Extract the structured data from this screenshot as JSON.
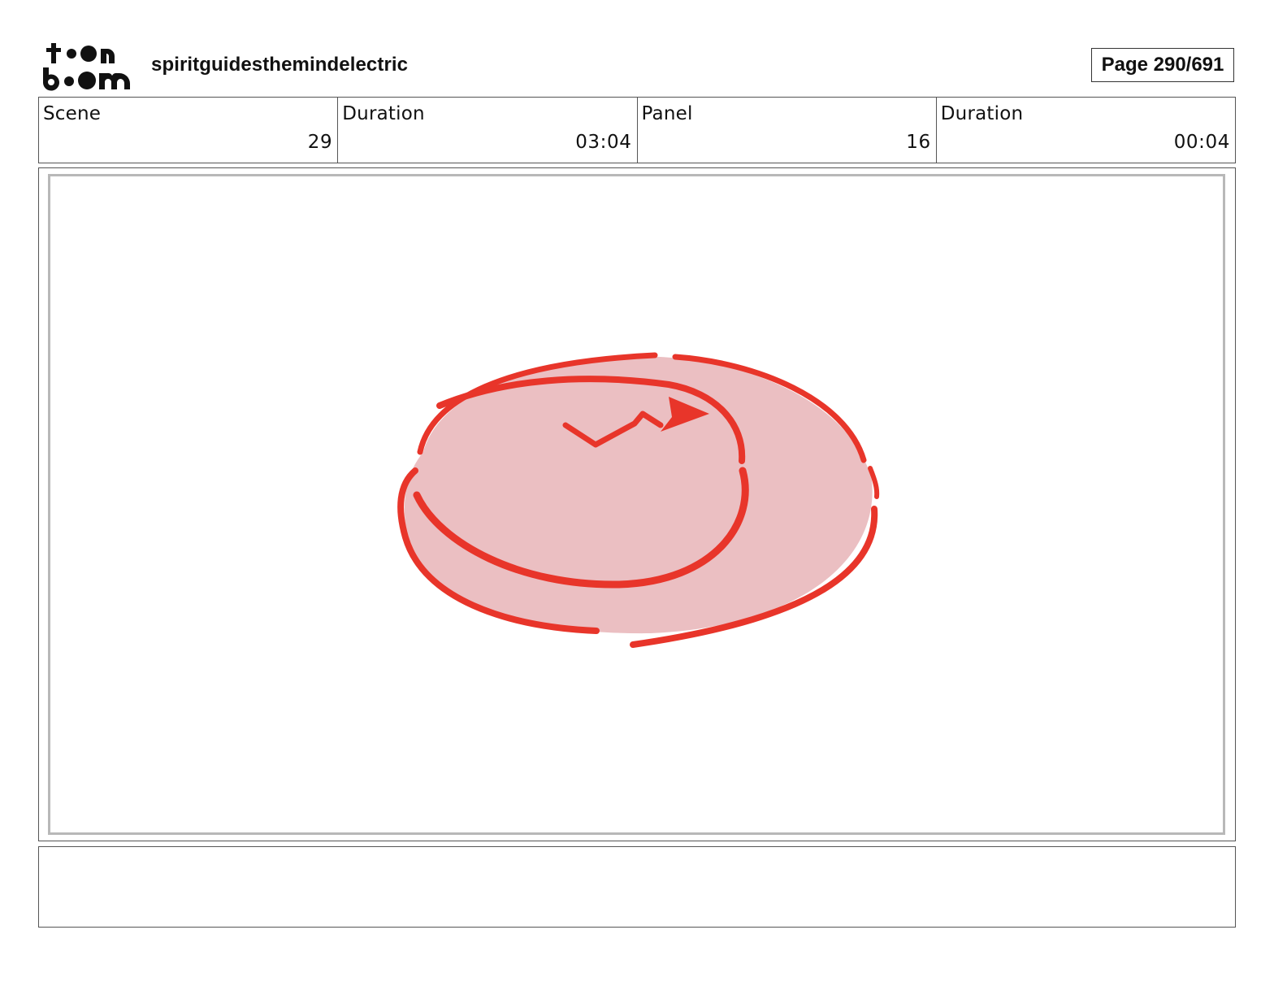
{
  "header": {
    "project_title": "spiritguidesthemindelectric",
    "page_label": "Page 290/691",
    "logo": {
      "line1": "toon",
      "line2": "boom"
    }
  },
  "info": {
    "scene_label": "Scene",
    "scene_value": "29",
    "scene_duration_label": "Duration",
    "scene_duration_value": "03:04",
    "panel_label": "Panel",
    "panel_value": "16",
    "panel_duration_label": "Duration",
    "panel_duration_value": "00:04"
  },
  "panel": {
    "drawing": "red-disc-sketch",
    "fill_color": "#EBBFC2",
    "stroke_color": "#E8352A"
  },
  "notes": {
    "text": ""
  }
}
